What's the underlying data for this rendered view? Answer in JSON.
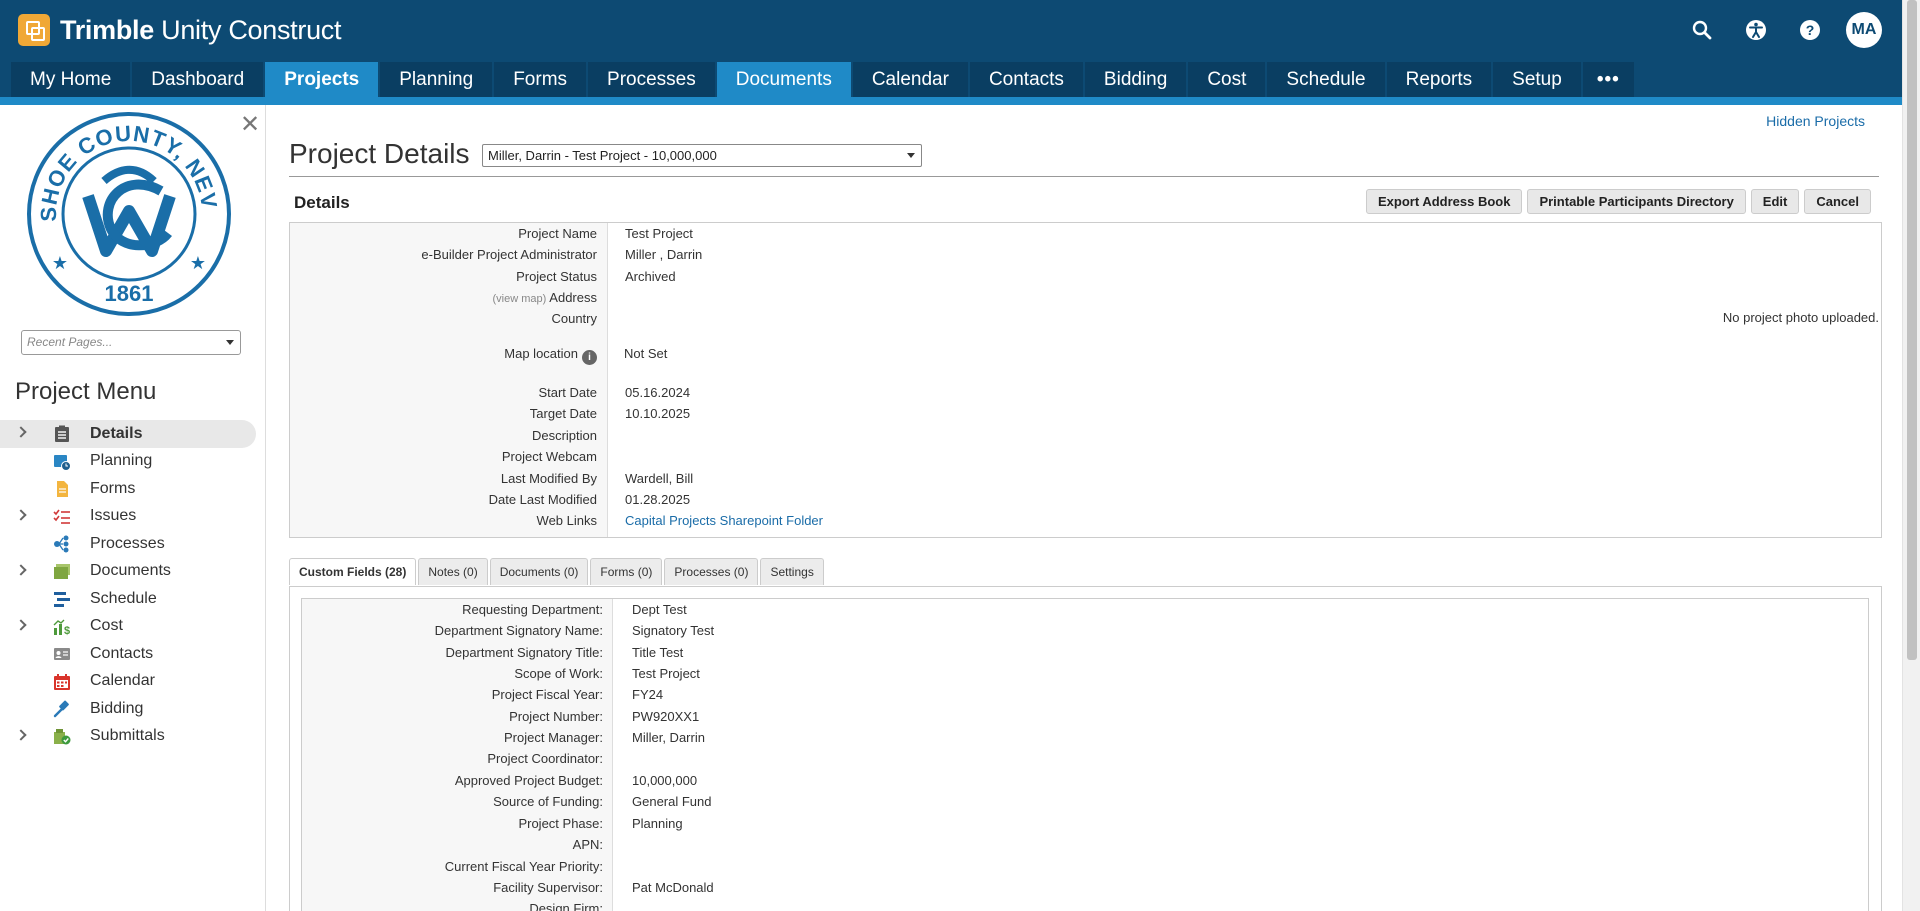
{
  "app": {
    "brand_bold": "Trimble",
    "brand_rest": " Unity Construct",
    "avatar": "MA"
  },
  "nav": {
    "tabs": [
      "My Home",
      "Dashboard",
      "Projects",
      "Planning",
      "Forms",
      "Processes",
      "Documents",
      "Calendar",
      "Contacts",
      "Bidding",
      "Cost",
      "Schedule",
      "Reports",
      "Setup"
    ],
    "more": "•••"
  },
  "sidebar": {
    "seal_text_top": "WASHOE COUNTY, NEVADA",
    "seal_year": "1861",
    "recent_placeholder": "Recent Pages...",
    "menu_title": "Project Menu",
    "items": [
      {
        "label": "Details",
        "icon": "clipboard-icon"
      },
      {
        "label": "Planning",
        "icon": "calendar-clock-icon"
      },
      {
        "label": "Forms",
        "icon": "form-icon"
      },
      {
        "label": "Issues",
        "icon": "checklist-icon"
      },
      {
        "label": "Processes",
        "icon": "process-icon"
      },
      {
        "label": "Documents",
        "icon": "folder-icon"
      },
      {
        "label": "Schedule",
        "icon": "schedule-icon"
      },
      {
        "label": "Cost",
        "icon": "cost-icon"
      },
      {
        "label": "Contacts",
        "icon": "contact-card-icon"
      },
      {
        "label": "Calendar",
        "icon": "calendar-icon"
      },
      {
        "label": "Bidding",
        "icon": "gavel-icon"
      },
      {
        "label": "Submittals",
        "icon": "submittals-icon"
      }
    ]
  },
  "main": {
    "hidden_projects": "Hidden Projects",
    "title": "Project Details",
    "project_select": "Miller, Darrin - Test Project - 10,000,000",
    "details_heading": "Details",
    "buttons": {
      "export": "Export Address Book",
      "printable": "Printable Participants Directory",
      "edit": "Edit",
      "cancel": "Cancel"
    },
    "view_map": "(view map)",
    "no_photo": "No project photo uploaded.",
    "details": [
      {
        "label": "Project Name",
        "value": "Test Project"
      },
      {
        "label": "e-Builder Project Administrator",
        "value": "Miller , Darrin"
      },
      {
        "label": "Project Status",
        "value": "Archived"
      },
      {
        "label": "Address",
        "value": ""
      },
      {
        "label": "Country",
        "value": ""
      },
      {
        "label": "Map location",
        "value": "Not Set"
      },
      {
        "label": "Start Date",
        "value": "05.16.2024"
      },
      {
        "label": "Target Date",
        "value": "10.10.2025"
      },
      {
        "label": "Description",
        "value": ""
      },
      {
        "label": "Project Webcam",
        "value": ""
      },
      {
        "label": "Last Modified By",
        "value": "Wardell, Bill"
      },
      {
        "label": "Date Last Modified",
        "value": "01.28.2025"
      },
      {
        "label": "Web Links",
        "value": "Capital Projects Sharepoint Folder"
      }
    ],
    "subtabs": [
      "Custom Fields (28)",
      "Notes (0)",
      "Documents (0)",
      "Forms (0)",
      "Processes (0)",
      "Settings"
    ],
    "custom_fields": [
      {
        "label": "Requesting Department:",
        "value": "Dept Test"
      },
      {
        "label": "Department Signatory Name:",
        "value": "Signatory Test"
      },
      {
        "label": "Department Signatory Title:",
        "value": "Title Test"
      },
      {
        "label": "Scope of Work:",
        "value": "Test Project"
      },
      {
        "label": "Project Fiscal Year:",
        "value": "FY24"
      },
      {
        "label": "Project Number:",
        "value": "PW920XX1"
      },
      {
        "label": "Project Manager:",
        "value": "Miller, Darrin"
      },
      {
        "label": "Project Coordinator:",
        "value": ""
      },
      {
        "label": "Approved Project Budget:",
        "value": "10,000,000"
      },
      {
        "label": "Source of Funding:",
        "value": "General Fund"
      },
      {
        "label": "Project Phase:",
        "value": "Planning"
      },
      {
        "label": "APN:",
        "value": ""
      },
      {
        "label": "Current Fiscal Year Priority:",
        "value": ""
      },
      {
        "label": "Facility Supervisor:",
        "value": "Pat McDonald"
      },
      {
        "label": "Design Firm:",
        "value": ""
      }
    ]
  }
}
